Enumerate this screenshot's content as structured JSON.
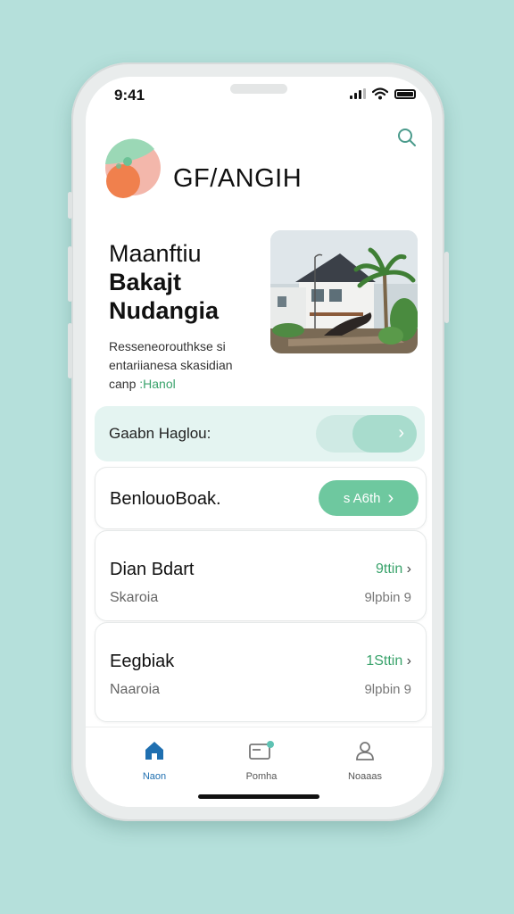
{
  "status": {
    "time": "9:41"
  },
  "header": {
    "app_name": "GF/ANGIH"
  },
  "hero": {
    "title_lines": [
      "Maanftiu",
      "Bakajt",
      "Nudangia"
    ],
    "desc_line1": "Resseneorouthkse",
    "desc_line1_suffix": "si",
    "desc_line2": "entariianesa skasidian",
    "desc_line3_prefix": "canp",
    "desc_line3_highlight": ":Hanol"
  },
  "search_card": {
    "label": "Gaabn Haglou:"
  },
  "cards": [
    {
      "title": "BenlouoBoak.",
      "button_label": "s A6th"
    },
    {
      "title": "Dian Bdart",
      "subtitle": "Skaroia",
      "right": "9ttin",
      "right_sub": "9lpbin 9"
    },
    {
      "title": "Eegbiak",
      "subtitle": "Naaroia",
      "right": "1Sttin",
      "right_sub": "9lpbin 9"
    }
  ],
  "nav": [
    {
      "label": "Naon",
      "icon": "home-icon",
      "active": true
    },
    {
      "label": "Pomha",
      "icon": "card-icon",
      "active": false
    },
    {
      "label": "Noaaas",
      "icon": "user-icon",
      "active": false
    }
  ],
  "colors": {
    "accent": "#6ec89f",
    "background": "#b5e0db",
    "active_nav": "#1f6fb0"
  }
}
